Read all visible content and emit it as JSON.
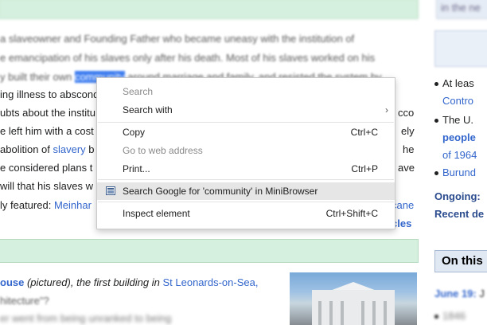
{
  "article": {
    "lines": [
      "a slaveowner and Founding Father who became uneasy with the institution of",
      "e emancipation of his slaves only after his death. Most of his slaves worked on his",
      "y built their own ",
      "community",
      " around marriage and family, and resisted the system by",
      "ing illness to abscond",
      "ubts about the institu",
      "e left him with a cost",
      "abolition of ",
      "slavery",
      " b",
      "e considered plans t",
      "will that his slaves w",
      "ly featured: ",
      "Meinhar",
      "cane",
      "cles"
    ],
    "right_fragments": {
      "ico": "cco",
      "ly": "ely",
      "he": "he",
      "ave": "ave"
    }
  },
  "dyk": {
    "lines": [
      "ouse",
      " (pictured), the first building in ",
      "St Leonards-on-Sea,",
      "hitecture\"?",
      "er went from being unranked to being"
    ]
  },
  "sidebar": {
    "top": "in the ne",
    "lines": [
      "At leas",
      "Contro",
      "The U.",
      "people",
      "of 1964",
      "Burund"
    ],
    "ongoing": "Ongoing:",
    "recent": "Recent de",
    "on_this_day": "On this",
    "date_line": "June 19:",
    "date_rest": "J",
    "sub_line": "1846"
  },
  "context_menu": {
    "items": [
      {
        "label": "Search",
        "enabled": false
      },
      {
        "label": "Search with",
        "enabled": true,
        "submenu": true
      },
      {
        "label": "Copy",
        "shortcut": "Ctrl+C",
        "enabled": true
      },
      {
        "label": "Go to web address",
        "enabled": false
      },
      {
        "label": "Print...",
        "shortcut": "Ctrl+P",
        "enabled": true
      },
      {
        "label": "Search Google for 'community' in MiniBrowser",
        "enabled": true,
        "highlighted": true,
        "icon": "minibrowser-icon"
      },
      {
        "label": "Inspect element",
        "shortcut": "Ctrl+Shift+C",
        "enabled": true
      }
    ],
    "arrow_glyph": "›"
  }
}
